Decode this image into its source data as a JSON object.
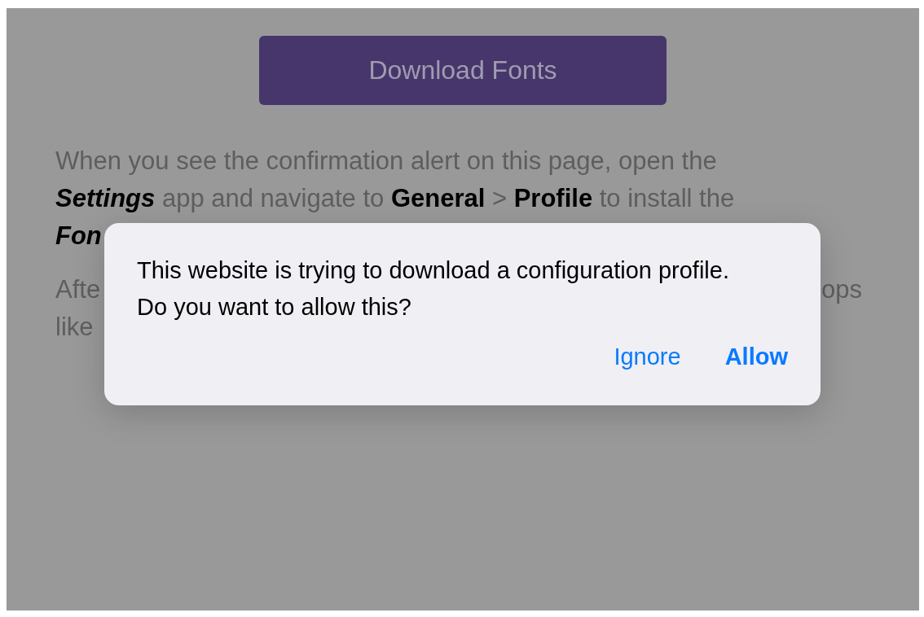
{
  "page": {
    "button": "Download Fonts",
    "paragraph_1": [
      [
        {
          "kind": "plain",
          "text": "When you see the confirmation alert on this page, open the"
        }
      ],
      [
        {
          "kind": "bold-italic",
          "text": "Settings"
        },
        {
          "kind": "plain",
          "text": " app and navigate to "
        },
        {
          "kind": "bold",
          "text": "General"
        },
        {
          "kind": "plain",
          "text": " > "
        },
        {
          "kind": "bold",
          "text": "Profile"
        },
        {
          "kind": "plain",
          "text": " to install the"
        }
      ],
      [
        {
          "kind": "bold-italic",
          "text": "Fon"
        }
      ]
    ],
    "paragraph_2_fragments": {
      "line_1_start": "Afte",
      "line_1_end": "ops",
      "line_2_start": "like"
    }
  },
  "alert": {
    "message": "This website is trying to download a configuration profile. Do you want to allow this?",
    "buttons": [
      {
        "label": "Ignore",
        "kind": "normal"
      },
      {
        "label": "Allow",
        "kind": "default"
      }
    ]
  }
}
